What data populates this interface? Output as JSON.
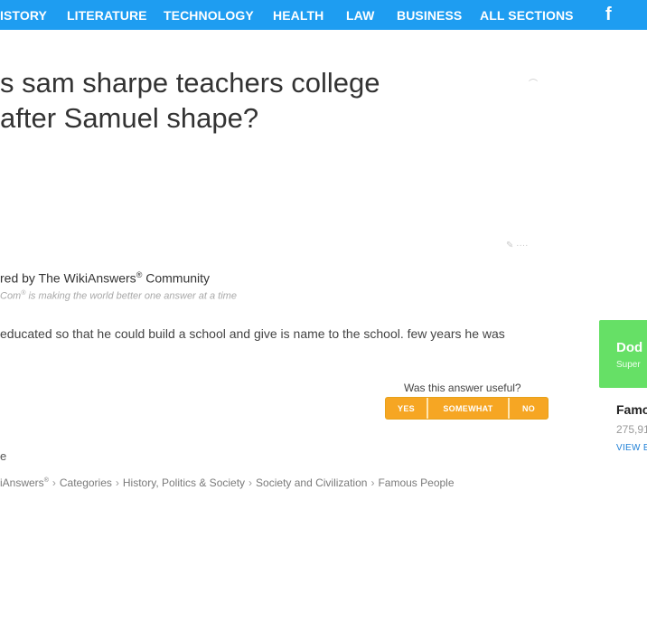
{
  "nav": {
    "items": [
      "ISTORY",
      "LITERATURE",
      "TECHNOLOGY",
      "HEALTH",
      "LAW",
      "BUSINESS",
      "ALL SECTIONS"
    ],
    "facebook_glyph": "f",
    "bar_color": "#1e9df1"
  },
  "question": {
    "line1": "s sam sharpe teachers college",
    "line2": "after Samuel shape?"
  },
  "answered_by": {
    "prefix": "red by The WikiAnswers",
    "reg": "®",
    "suffix": " Community"
  },
  "tagline": {
    "prefix": "Com",
    "reg": "®",
    "suffix": " is making the world better one answer at a time"
  },
  "answer_text": "educated so that he could build a school and give is name to the school. few years he was",
  "feedback": {
    "question": "Was this answer useful?",
    "yes": "YES",
    "somewhat": "SOMEWHAT",
    "no": "NO",
    "button_color": "#f6a623"
  },
  "stray_letter": "e",
  "breadcrumb": {
    "home_prefix": "iAnswers",
    "home_reg": "®",
    "items": [
      "Categories",
      "History, Politics & Society",
      "Society and Civilization",
      "Famous People"
    ]
  },
  "sidebar": {
    "card_title": "Dod",
    "card_sub": "Super",
    "card_color": "#66e066",
    "heading": "Famo",
    "count": "275,91",
    "view_link": "VIEW E"
  }
}
